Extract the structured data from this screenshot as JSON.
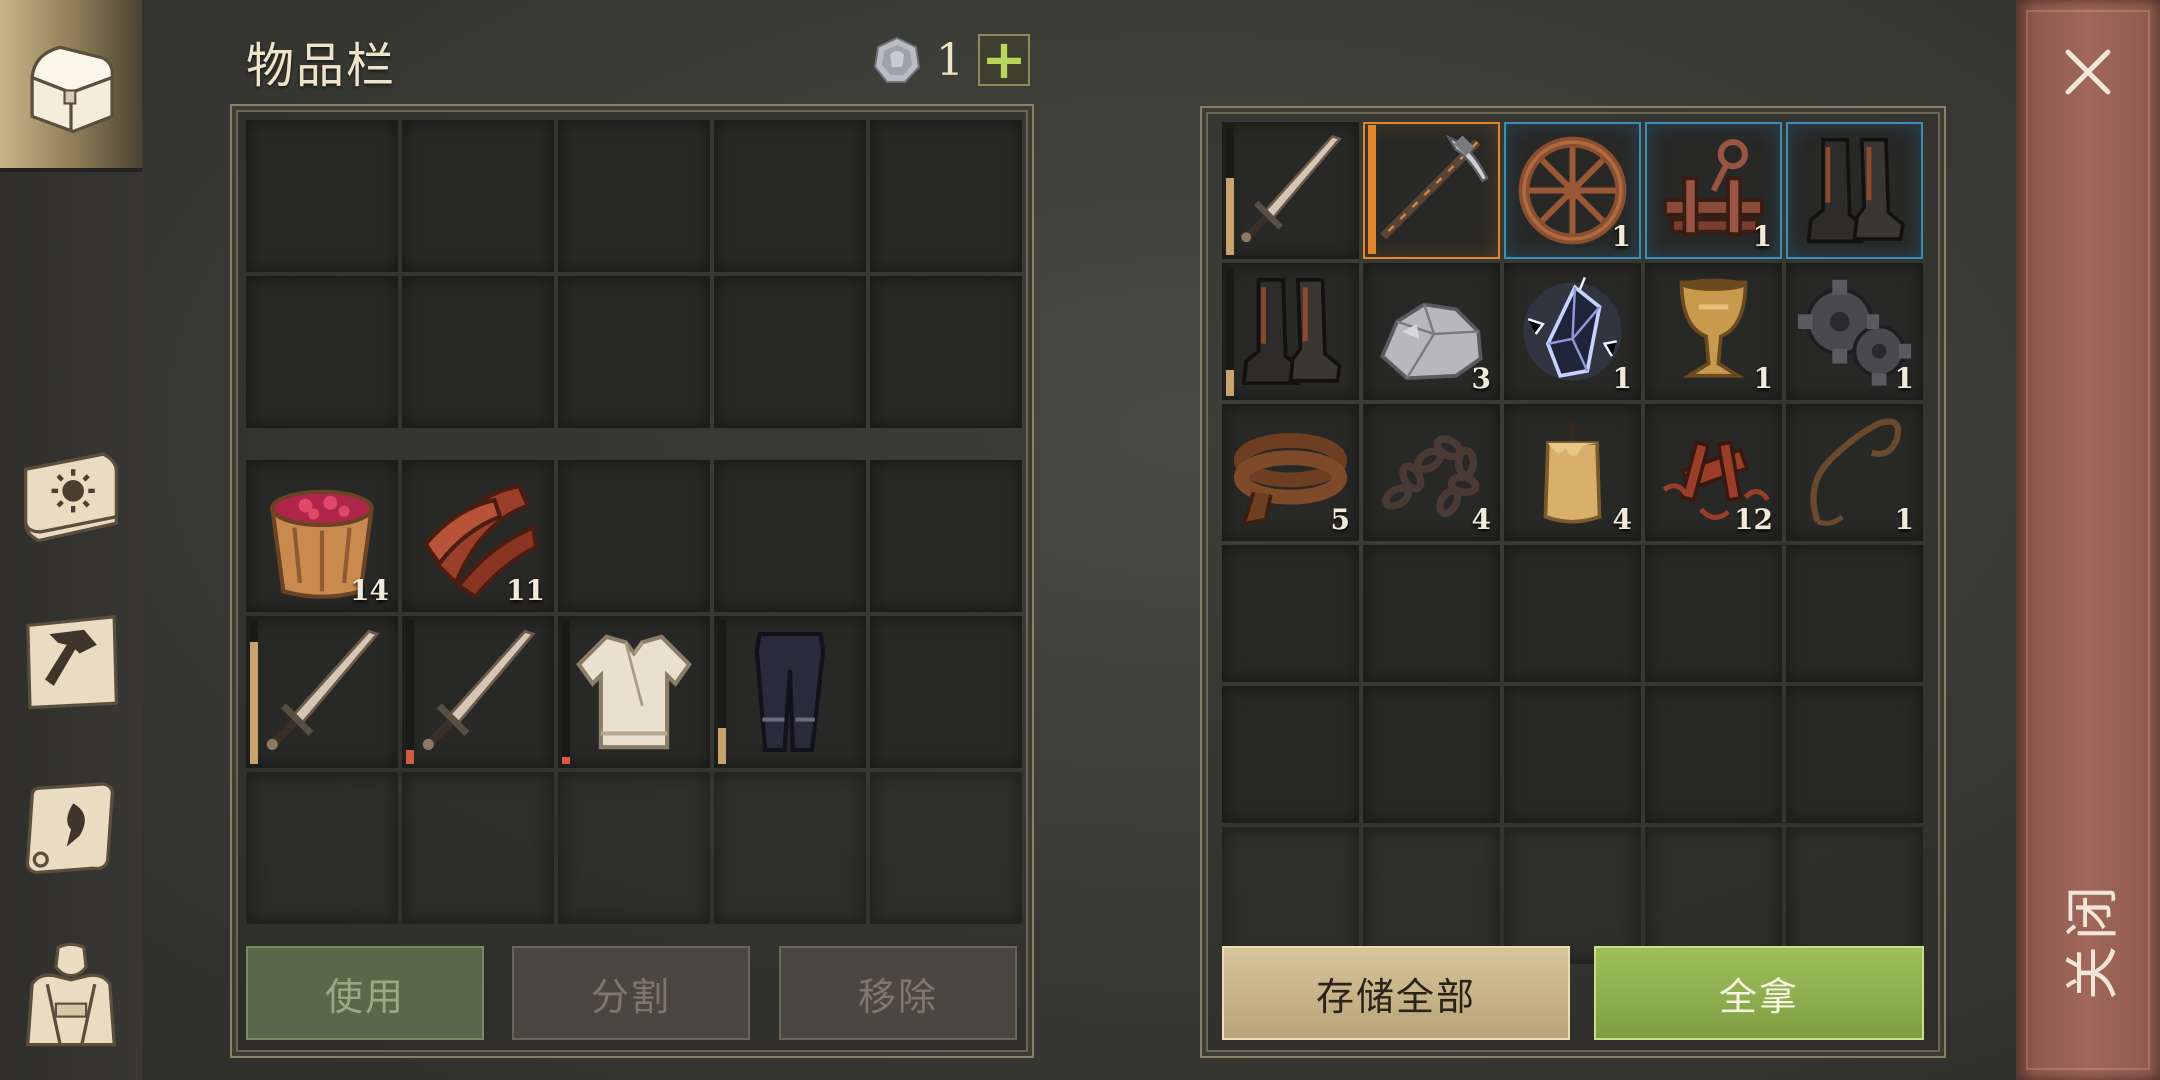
{
  "inventory": {
    "title": "物品栏",
    "currency": {
      "icon": "silver-coin-icon",
      "count": "1"
    },
    "plus_label": "+",
    "rows": [
      [
        null,
        null,
        null,
        null,
        null
      ],
      [
        null,
        null,
        null,
        null,
        null
      ],
      [
        {
          "name": "berry-bucket",
          "icon": "berry-bucket-icon",
          "count": "14"
        },
        {
          "name": "leather-strips",
          "icon": "leather-strips-icon",
          "count": "11"
        },
        null,
        null,
        null
      ],
      [
        {
          "name": "bronze-sword",
          "icon": "sword-icon",
          "count": "",
          "durability": 0.85,
          "durability_color": "#c8a46a"
        },
        {
          "name": "copper-sword",
          "icon": "sword-icon",
          "count": "",
          "durability": 0.1,
          "durability_color": "#d25b45"
        },
        {
          "name": "linen-shirt",
          "icon": "shirt-icon",
          "count": "",
          "durability": 0.05,
          "durability_color": "#d25b45"
        },
        {
          "name": "dark-pants",
          "icon": "pants-icon",
          "count": "",
          "durability": 0.25,
          "durability_color": "#c8a46a"
        },
        null
      ],
      [
        null,
        null,
        null,
        null,
        null
      ]
    ],
    "buttons": {
      "use": "使用",
      "split": "分割",
      "remove": "移除"
    }
  },
  "storage": {
    "rows": [
      [
        {
          "name": "steel-sword",
          "icon": "sword-icon",
          "count": "",
          "durability": 0.6,
          "durability_color": "#c8a46a"
        },
        {
          "name": "pickaxe",
          "icon": "pickaxe-icon",
          "count": "",
          "rarity": "epic",
          "durability": 1.0,
          "durability_color": "#e0862c"
        },
        {
          "name": "wooden-wheel",
          "icon": "wheel-icon",
          "count": "1",
          "rarity": "rare"
        },
        {
          "name": "mechanism-part",
          "icon": "mechanism-icon",
          "count": "1",
          "rarity": "rare"
        },
        {
          "name": "leather-boots",
          "icon": "boots-icon",
          "count": "",
          "rarity": "rare"
        }
      ],
      [
        {
          "name": "black-boots",
          "icon": "boots-icon",
          "count": "",
          "durability": 0.2,
          "durability_color": "#c8a46a"
        },
        {
          "name": "stone-ore",
          "icon": "ore-icon",
          "count": "3"
        },
        {
          "name": "energy-crystal",
          "icon": "crystal-icon",
          "count": "1"
        },
        {
          "name": "golden-goblet",
          "icon": "goblet-icon",
          "count": "1"
        },
        {
          "name": "iron-gear",
          "icon": "gear-icon",
          "count": "1"
        }
      ],
      [
        {
          "name": "leather-belt",
          "icon": "belt-icon",
          "count": "5"
        },
        {
          "name": "iron-chain",
          "icon": "chain-icon",
          "count": "4"
        },
        {
          "name": "wax-candle",
          "icon": "candle-icon",
          "count": "4"
        },
        {
          "name": "copper-scrap",
          "icon": "scrap-icon",
          "count": "12"
        },
        {
          "name": "rope",
          "icon": "rope-icon",
          "count": "1"
        }
      ],
      [
        null,
        null,
        null,
        null,
        null
      ],
      [
        null,
        null,
        null,
        null,
        null
      ],
      [
        null,
        null,
        null,
        null,
        null
      ]
    ],
    "buttons": {
      "store_all": "存储全部",
      "take_all": "全拿"
    }
  },
  "close": {
    "label": "关闭"
  },
  "tabs": [
    {
      "name": "tab-chest",
      "icon": "chest-icon",
      "active": true
    },
    {
      "name": "tab-journal",
      "icon": "sun-book-icon",
      "active": false
    },
    {
      "name": "tab-crafting",
      "icon": "hammer-map-icon",
      "active": false
    },
    {
      "name": "tab-quests",
      "icon": "scroll-icon",
      "active": false
    },
    {
      "name": "tab-character",
      "icon": "character-icon",
      "active": false
    }
  ]
}
